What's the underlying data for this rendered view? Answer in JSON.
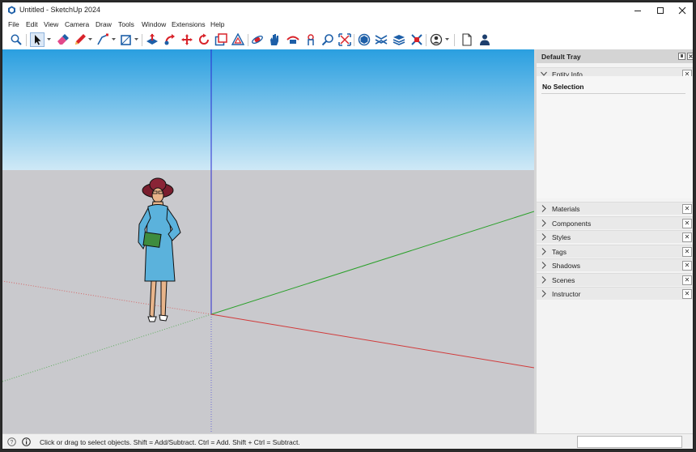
{
  "window": {
    "title": "Untitled - SketchUp 2024",
    "controls": [
      "minimize-icon",
      "maximize-icon",
      "close-icon"
    ]
  },
  "menu": [
    "File",
    "Edit",
    "View",
    "Camera",
    "Draw",
    "Tools",
    "Window",
    "Extensions",
    "Help"
  ],
  "toolbar": {
    "selected_tool": "select",
    "tools": [
      "zoom-icon",
      "select-icon",
      "eraser-icon",
      "pencil-icon",
      "line-icon",
      "rectangle-icon",
      "push-pull-icon",
      "follow-me-icon",
      "move-icon",
      "rotate-icon",
      "scale-icon",
      "offset-icon",
      "orbit-icon",
      "pan-icon",
      "zoom-window-icon",
      "zoom-extents-icon",
      "look-around-icon",
      "walk-icon",
      "position-camera-icon",
      "section-plane-icon",
      "warehouse-icon",
      "extension-warehouse-icon",
      "layout-icon",
      "profile-icon",
      "new-file-icon",
      "user-icon"
    ]
  },
  "tray": {
    "title": "Default Tray",
    "entity_info": {
      "label": "Entity Info",
      "selection_text": "No Selection"
    },
    "panels": [
      {
        "label": "Materials"
      },
      {
        "label": "Components"
      },
      {
        "label": "Styles"
      },
      {
        "label": "Tags"
      },
      {
        "label": "Shadows"
      },
      {
        "label": "Scenes"
      },
      {
        "label": "Instructor"
      }
    ]
  },
  "statusbar": {
    "hint": "Click or drag to select objects. Shift = Add/Subtract. Ctrl = Add. Shift + Ctrl = Subtract.",
    "measurements_value": ""
  },
  "colors": {
    "sky_top": "#2a9fe0",
    "sky_bottom": "#cfe9f6",
    "ground": "#c9c9cd",
    "axis_red": "#d13a3a",
    "axis_green": "#2aa02a",
    "axis_blue": "#2a2ad0",
    "icon_blue": "#1d5fa8",
    "icon_red": "#d8232a"
  }
}
